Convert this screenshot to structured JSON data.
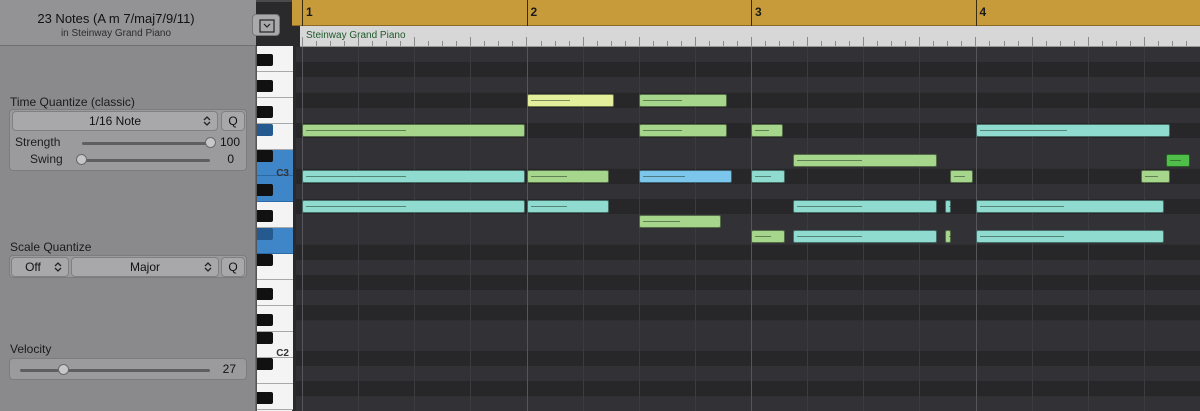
{
  "inspector": {
    "title": "23 Notes (A m 7/maj7/9/11)",
    "subtitle": "in Steinway Grand Piano",
    "time_quantize": {
      "label": "Time Quantize (classic)",
      "value": "1/16 Note",
      "q_label": "Q",
      "strength_label": "Strength",
      "strength_value": "100",
      "strength_level": 1.0,
      "swing_label": "Swing",
      "swing_value": "0",
      "swing_level": 0.0
    },
    "scale_quantize": {
      "label": "Scale Quantize",
      "root_value": "Off",
      "scale_value": "Major",
      "q_label": "Q"
    },
    "velocity": {
      "label": "Velocity",
      "value": "27",
      "level": 0.21
    }
  },
  "keyboard": {
    "labels": [
      "C3",
      "C2"
    ]
  },
  "ruler": {
    "bars": [
      "1",
      "2",
      "3",
      "4"
    ],
    "region_name": "Steinway Grand Piano"
  },
  "colors": {
    "green": "#a6d68c",
    "yellow": "#e3ef9a",
    "teal": "#8fdbd0",
    "blue": "#7cc6ec",
    "bright_green": "#4fbf4a"
  },
  "notes": [
    {
      "bar": 1,
      "beat": 1,
      "len_beats": 4.0,
      "row": 5,
      "color": "green"
    },
    {
      "bar": 1,
      "beat": 1,
      "len_beats": 4.0,
      "row": 8,
      "color": "teal"
    },
    {
      "bar": 1,
      "beat": 1,
      "len_beats": 4.0,
      "row": 10,
      "color": "teal"
    },
    {
      "bar": 2,
      "beat": 1,
      "len_beats": 1.6,
      "row": 3,
      "color": "yellow"
    },
    {
      "bar": 2,
      "beat": 1,
      "len_beats": 1.5,
      "row": 8,
      "color": "green"
    },
    {
      "bar": 2,
      "beat": 1,
      "len_beats": 1.5,
      "row": 10,
      "color": "teal"
    },
    {
      "bar": 2,
      "beat": 3,
      "len_beats": 1.6,
      "row": 3,
      "color": "green"
    },
    {
      "bar": 2,
      "beat": 3,
      "len_beats": 1.6,
      "row": 5,
      "color": "green"
    },
    {
      "bar": 2,
      "beat": 3,
      "len_beats": 1.7,
      "row": 8,
      "color": "blue"
    },
    {
      "bar": 2,
      "beat": 3,
      "len_beats": 1.5,
      "row": 11,
      "color": "green"
    },
    {
      "bar": 3,
      "beat": 1,
      "len_beats": 0.6,
      "row": 5,
      "color": "green"
    },
    {
      "bar": 3,
      "beat": 1,
      "len_beats": 0.65,
      "row": 8,
      "color": "teal"
    },
    {
      "bar": 3,
      "beat": 1,
      "len_beats": 0.65,
      "row": 12,
      "color": "green"
    },
    {
      "bar": 3,
      "beat": 1.75,
      "len_beats": 2.6,
      "row": 7,
      "color": "green"
    },
    {
      "bar": 3,
      "beat": 1.75,
      "len_beats": 2.6,
      "row": 10,
      "color": "teal"
    },
    {
      "bar": 3,
      "beat": 1.75,
      "len_beats": 2.6,
      "row": 12,
      "color": "teal"
    },
    {
      "bar": 3,
      "beat": 4.55,
      "len_beats": 0.45,
      "row": 8,
      "color": "green"
    },
    {
      "bar": 3,
      "beat": 4.45,
      "len_beats": 0.15,
      "row": 10,
      "color": "teal"
    },
    {
      "bar": 3,
      "beat": 4.45,
      "len_beats": 0.15,
      "row": 12,
      "color": "green"
    },
    {
      "bar": 4,
      "beat": 1,
      "len_beats": 3.5,
      "row": 5,
      "color": "teal"
    },
    {
      "bar": 4,
      "beat": 1,
      "len_beats": 3.4,
      "row": 10,
      "color": "teal"
    },
    {
      "bar": 4,
      "beat": 1,
      "len_beats": 3.4,
      "row": 12,
      "color": "teal"
    },
    {
      "bar": 4,
      "beat": 3.95,
      "len_beats": 0.55,
      "row": 8,
      "color": "green"
    },
    {
      "bar": 4,
      "beat": 4.4,
      "len_beats": 0.45,
      "row": 7,
      "color": "bright_green"
    }
  ]
}
